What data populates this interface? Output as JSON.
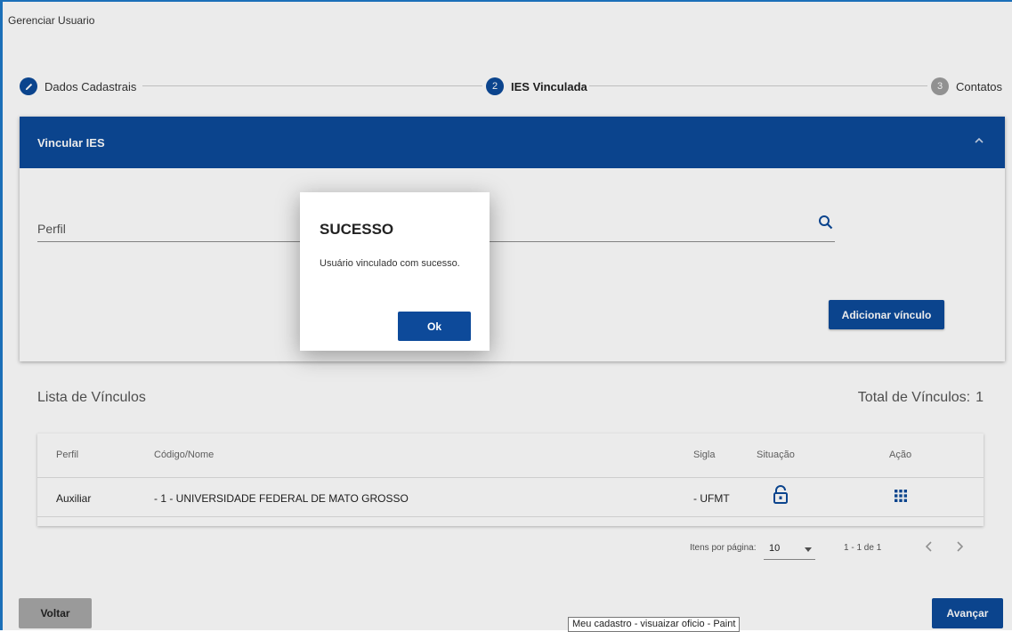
{
  "page": {
    "title": "Gerenciar Usuario"
  },
  "stepper": {
    "steps": [
      {
        "number": "",
        "label": "Dados Cadastrais",
        "state": "done",
        "icon": "pencil-icon"
      },
      {
        "number": "2",
        "label": "IES Vinculada",
        "state": "active"
      },
      {
        "number": "3",
        "label": "Contatos",
        "state": "todo"
      }
    ]
  },
  "panel": {
    "title": "Vincular IES",
    "collapse_icon": "chevron-up-icon",
    "perfil_label": "Perfil",
    "search_icon": "search-icon",
    "add_button": "Adicionar vínculo"
  },
  "modal": {
    "title": "SUCESSO",
    "message": "Usuário vinculado com sucesso.",
    "ok_button": "Ok"
  },
  "list": {
    "title": "Lista de Vínculos",
    "total_label": "Total de Vínculos:",
    "total_value": "1",
    "columns": [
      "Perfil",
      "Código/Nome",
      "Sigla",
      "Situação",
      "Ação"
    ],
    "rows": [
      {
        "perfil": "Auxiliar",
        "codigo_nome": "- 1 - UNIVERSIDADE FEDERAL DE MATO GROSSO",
        "sigla": "- UFMT",
        "situacao_icon": "unlock-icon",
        "acao_icon": "grid-menu-icon"
      }
    ]
  },
  "paginator": {
    "items_label": "Itens por página:",
    "page_size": "10",
    "range": "1 - 1 de 1",
    "prev_icon": "chevron-left-icon",
    "next_icon": "chevron-right-icon"
  },
  "footer": {
    "back_button": "Voltar",
    "next_button": "Avançar",
    "tooltip": "Meu cadastro - visuaizar oficio - Paint"
  },
  "colors": {
    "primary": "#0d4a9a",
    "frame": "#1e79c8",
    "step_inactive": "#9e9e9e",
    "back_button": "#a8a8a8"
  }
}
